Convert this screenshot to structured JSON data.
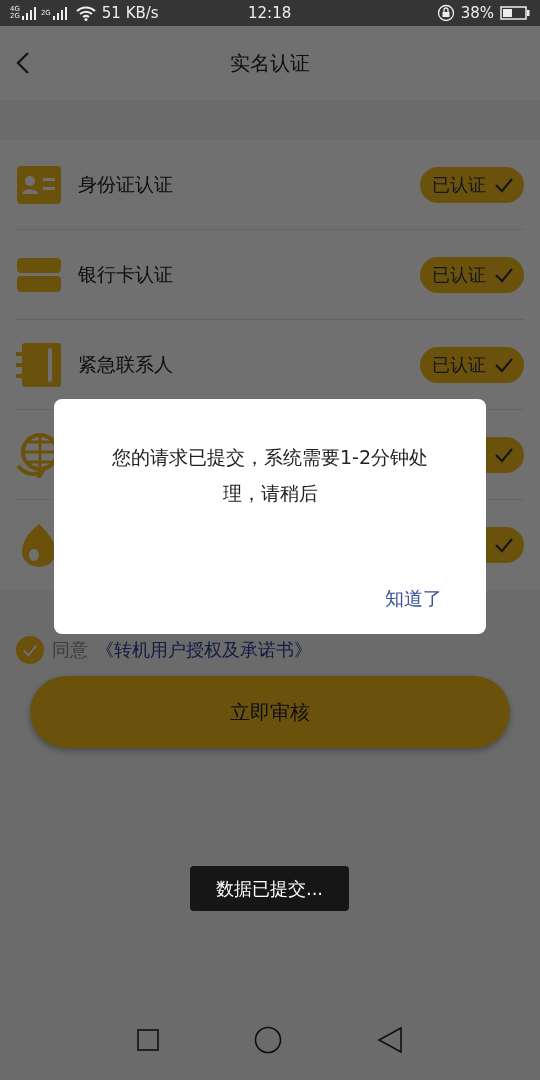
{
  "status_bar": {
    "networks": [
      {
        "labels": [
          "4G",
          "2G"
        ]
      },
      {
        "labels": [
          "2G"
        ]
      }
    ],
    "speed": "51 KB/s",
    "time": "12:18",
    "battery": "38%"
  },
  "header": {
    "title": "实名认证"
  },
  "items": [
    {
      "kind": "id-card",
      "label": "身份证认证",
      "badge": "已认证",
      "verified": true
    },
    {
      "kind": "bank-card",
      "label": "银行卡认证",
      "badge": "已认证",
      "verified": true
    },
    {
      "kind": "contacts",
      "label": "紧急联系人",
      "badge": "已认证",
      "verified": true
    },
    {
      "kind": "globe",
      "verified": true
    },
    {
      "kind": "drop",
      "verified": true
    }
  ],
  "agreement": {
    "checked": true,
    "label": "同意",
    "link": "《转机用户授权及承诺书》"
  },
  "submit_button": "立即审核",
  "dialog": {
    "message": "您的请求已提交，系统需要1-2分钟处理，请稍后",
    "button": "知道了"
  },
  "toast": "数据已提交..."
}
